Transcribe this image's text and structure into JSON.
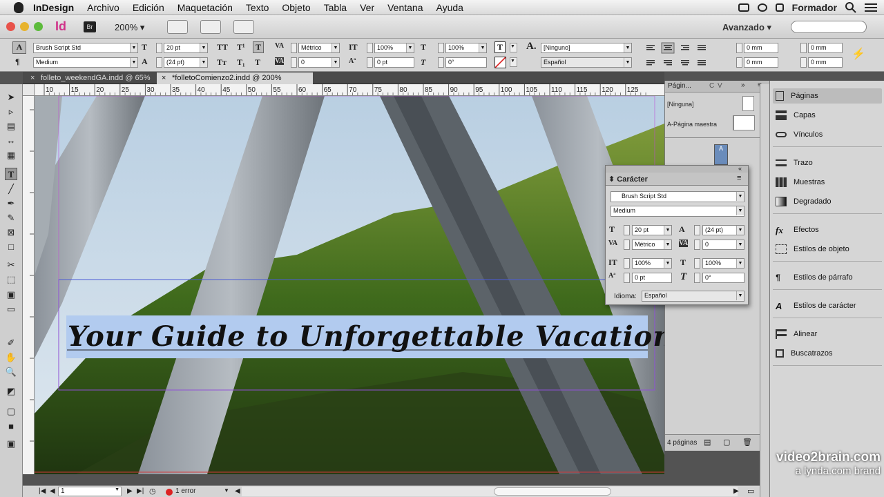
{
  "menubar": {
    "app": "InDesign",
    "items": [
      "Archivo",
      "Edición",
      "Maquetación",
      "Texto",
      "Objeto",
      "Tabla",
      "Ver",
      "Ventana",
      "Ayuda"
    ],
    "right_label": "Formador"
  },
  "appbar": {
    "id_logo": "Id",
    "br_logo": "Br",
    "zoom": "200%",
    "workspace": "Avanzado"
  },
  "control": {
    "font": "Brush Script Std",
    "style": "Medium",
    "size": "20 pt",
    "leading": "(24 pt)",
    "kerning": "Métrico",
    "tracking": "0",
    "vscale": "100%",
    "hscale": "100%",
    "baseline": "0 pt",
    "skew": "0°",
    "char_style": "[Ninguno]",
    "language": "Español",
    "indent1": "0 mm",
    "indent2": "0 mm",
    "indent3": "0 mm",
    "indent4": "0 mm"
  },
  "tabs": [
    {
      "label": "folleto_weekendGA.indd @ 65%"
    },
    {
      "label": "*folletoComienzo2.indd @ 200%"
    }
  ],
  "ruler_ticks": [
    "10",
    "15",
    "20",
    "25",
    "30",
    "35",
    "40",
    "45",
    "50",
    "55",
    "60",
    "65",
    "70",
    "75",
    "80",
    "85",
    "90",
    "95",
    "100",
    "105",
    "110",
    "115",
    "120",
    "125"
  ],
  "canvas": {
    "headline": "Your Guide to Unforgettable Vacations!"
  },
  "pages_panel": {
    "tab": "Págin...",
    "tab2": "C",
    "tab3": "V",
    "none_label": "[Ninguna]",
    "master_label": "A-Página maestra",
    "page_letter": "A",
    "count": "4 páginas"
  },
  "character_panel": {
    "title": "Carácter",
    "font": "Brush Script Std",
    "style": "Medium",
    "size": "20 pt",
    "leading": "(24 pt)",
    "kerning": "Métrico",
    "tracking": "0",
    "vscale": "100%",
    "hscale": "100%",
    "baseline": "0 pt",
    "skew": "0°",
    "language_label": "Idioma:",
    "language": "Español"
  },
  "dock": {
    "items": [
      "Páginas",
      "Capas",
      "Vínculos",
      "Trazo",
      "Muestras",
      "Degradado",
      "Efectos",
      "Estilos de objeto",
      "Estilos de párrafo",
      "Estilos de carácter",
      "Alinear",
      "Buscatrazos"
    ]
  },
  "status": {
    "page": "1",
    "errors": "1 error"
  },
  "watermark": {
    "line1": "video2brain.com",
    "line2": "a lynda.com brand"
  }
}
